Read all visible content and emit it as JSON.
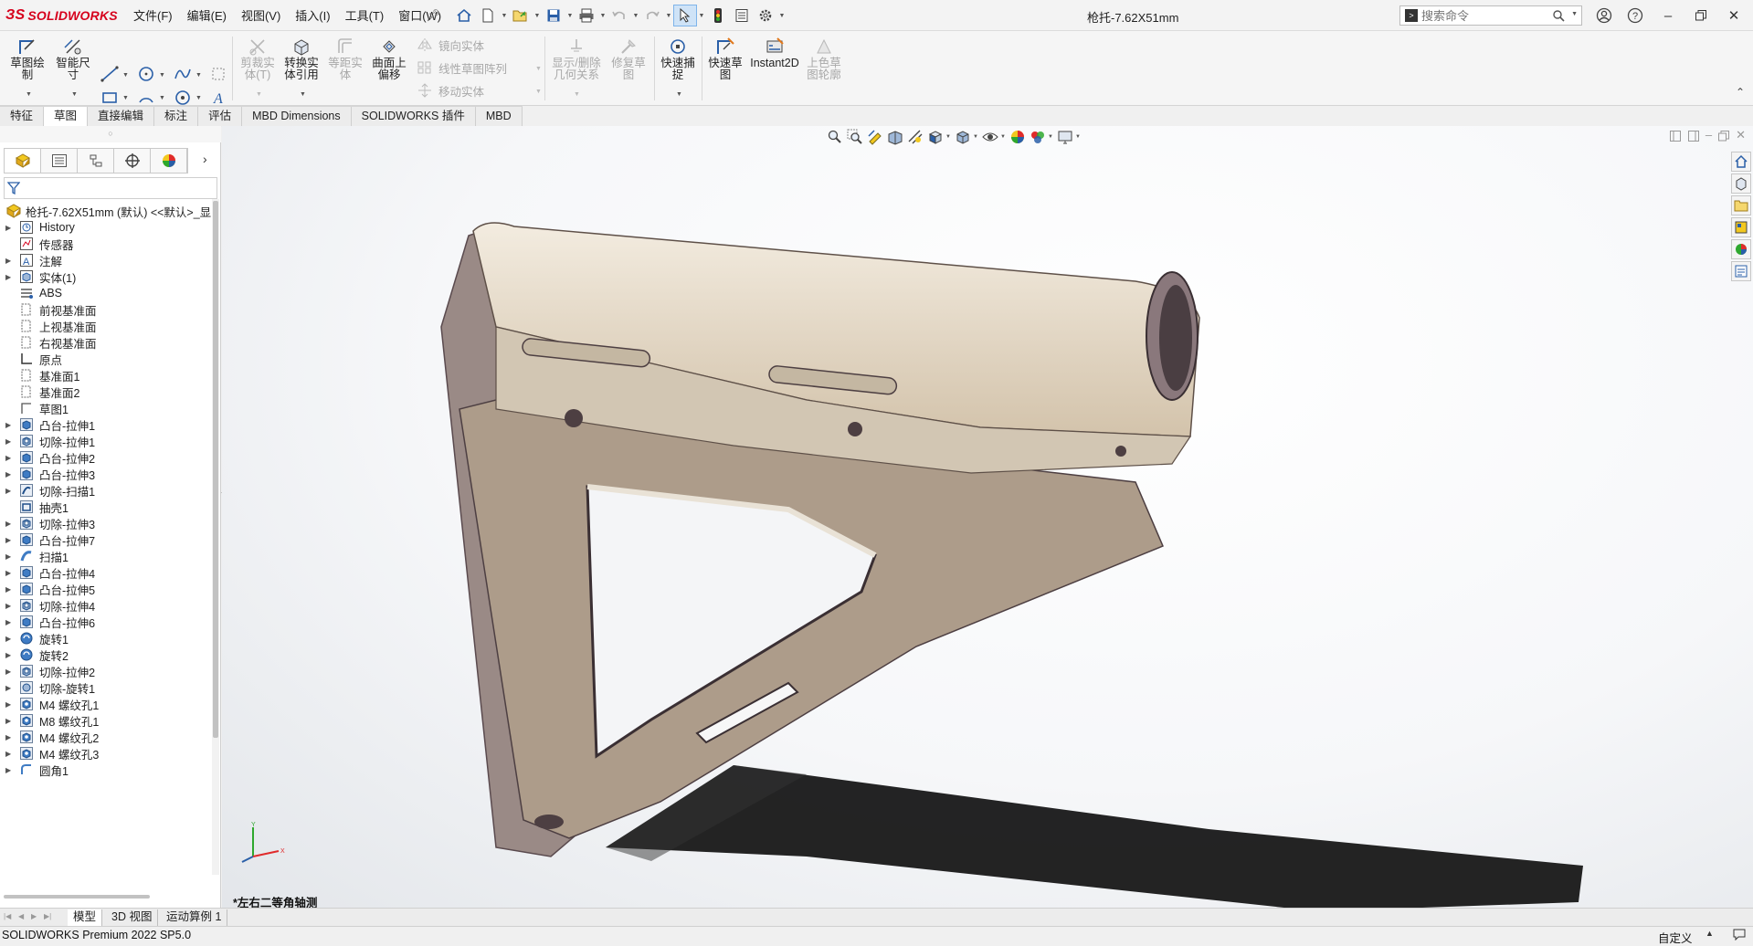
{
  "app": {
    "logo_text": "SOLIDWORKS",
    "logo_mark": "ЗS",
    "brand_color": "#d6001c",
    "document_title": "枪托-7.62X51mm"
  },
  "menus": [
    "文件(F)",
    "编辑(E)",
    "视图(V)",
    "插入(I)",
    "工具(T)",
    "窗口(W)"
  ],
  "search": {
    "placeholder": "搜索命令"
  },
  "ribbon": {
    "sketch": "草图绘制",
    "smart_dim": "智能尺寸",
    "trim": "剪裁实体(T)",
    "convert": "转换实体引用",
    "offset": "等距实体",
    "surface_offset": "曲面上偏移",
    "mirror": "镜向实体",
    "linear_pattern": "线性草图阵列",
    "move": "移动实体",
    "display_relations": "显示/删除几何关系",
    "repair": "修复草图",
    "quick_snap": "快速捕捉",
    "rapid_sketch": "快速草图",
    "instant2d": "Instant2D",
    "shaded_sketch": "上色草图轮廓"
  },
  "tabs": [
    {
      "label": "特征",
      "active": false
    },
    {
      "label": "草图",
      "active": true
    },
    {
      "label": "直接编辑",
      "active": false
    },
    {
      "label": "标注",
      "active": false
    },
    {
      "label": "评估",
      "active": false
    },
    {
      "label": "MBD Dimensions",
      "active": false
    },
    {
      "label": "SOLIDWORKS 插件",
      "active": false
    },
    {
      "label": "MBD",
      "active": false
    }
  ],
  "tree": {
    "root": "枪托-7.62X51mm (默认) <<默认>_显",
    "items": [
      {
        "label": "History",
        "icon": "history-icon",
        "expander": true
      },
      {
        "label": "传感器",
        "icon": "sensor-icon",
        "expander": false
      },
      {
        "label": "注解",
        "icon": "annotation-icon",
        "expander": true
      },
      {
        "label": "实体(1)",
        "icon": "solid-bodies-icon",
        "expander": true
      },
      {
        "label": "ABS",
        "icon": "material-icon",
        "expander": false
      },
      {
        "label": "前视基准面",
        "icon": "plane-icon",
        "expander": false
      },
      {
        "label": "上视基准面",
        "icon": "plane-icon",
        "expander": false
      },
      {
        "label": "右视基准面",
        "icon": "plane-icon",
        "expander": false
      },
      {
        "label": "原点",
        "icon": "origin-icon",
        "expander": false
      },
      {
        "label": "基准面1",
        "icon": "plane-icon",
        "expander": false
      },
      {
        "label": "基准面2",
        "icon": "plane-icon",
        "expander": false
      },
      {
        "label": "草图1",
        "icon": "sketch-icon",
        "expander": false
      },
      {
        "label": "凸台-拉伸1",
        "icon": "extrude-icon",
        "expander": true
      },
      {
        "label": "切除-拉伸1",
        "icon": "cut-extrude-icon",
        "expander": true
      },
      {
        "label": "凸台-拉伸2",
        "icon": "extrude-icon",
        "expander": true
      },
      {
        "label": "凸台-拉伸3",
        "icon": "extrude-icon",
        "expander": true
      },
      {
        "label": "切除-扫描1",
        "icon": "cut-sweep-icon",
        "expander": true
      },
      {
        "label": "抽壳1",
        "icon": "shell-icon",
        "expander": false
      },
      {
        "label": "切除-拉伸3",
        "icon": "cut-extrude-icon",
        "expander": true
      },
      {
        "label": "凸台-拉伸7",
        "icon": "extrude-icon",
        "expander": true
      },
      {
        "label": "扫描1",
        "icon": "sweep-icon",
        "expander": true
      },
      {
        "label": "凸台-拉伸4",
        "icon": "extrude-icon",
        "expander": true
      },
      {
        "label": "凸台-拉伸5",
        "icon": "extrude-icon",
        "expander": true
      },
      {
        "label": "切除-拉伸4",
        "icon": "cut-extrude-icon",
        "expander": true
      },
      {
        "label": "凸台-拉伸6",
        "icon": "extrude-icon",
        "expander": true
      },
      {
        "label": "旋转1",
        "icon": "revolve-icon",
        "expander": true
      },
      {
        "label": "旋转2",
        "icon": "revolve-icon",
        "expander": true
      },
      {
        "label": "切除-拉伸2",
        "icon": "cut-extrude-icon",
        "expander": true
      },
      {
        "label": "切除-旋转1",
        "icon": "cut-revolve-icon",
        "expander": true
      },
      {
        "label": "M4 螺纹孔1",
        "icon": "hole-wizard-icon",
        "expander": true
      },
      {
        "label": "M8 螺纹孔1",
        "icon": "hole-wizard-icon",
        "expander": true
      },
      {
        "label": "M4 螺纹孔2",
        "icon": "hole-wizard-icon",
        "expander": true
      },
      {
        "label": "M4 螺纹孔3",
        "icon": "hole-wizard-icon",
        "expander": true
      },
      {
        "label": "圆角1",
        "icon": "fillet-icon",
        "expander": true
      }
    ]
  },
  "viewport": {
    "view_name": "*左右二等角轴测",
    "model_body_color": "#d9ccb8",
    "model_shadow_color": "#8a7a80"
  },
  "bottom_tabs": [
    {
      "label": "模型",
      "active": true
    },
    {
      "label": "3D 视图",
      "active": false
    },
    {
      "label": "运动算例 1",
      "active": false
    }
  ],
  "status": {
    "left": "SOLIDWORKS Premium 2022 SP5.0",
    "custom": "自定义"
  }
}
